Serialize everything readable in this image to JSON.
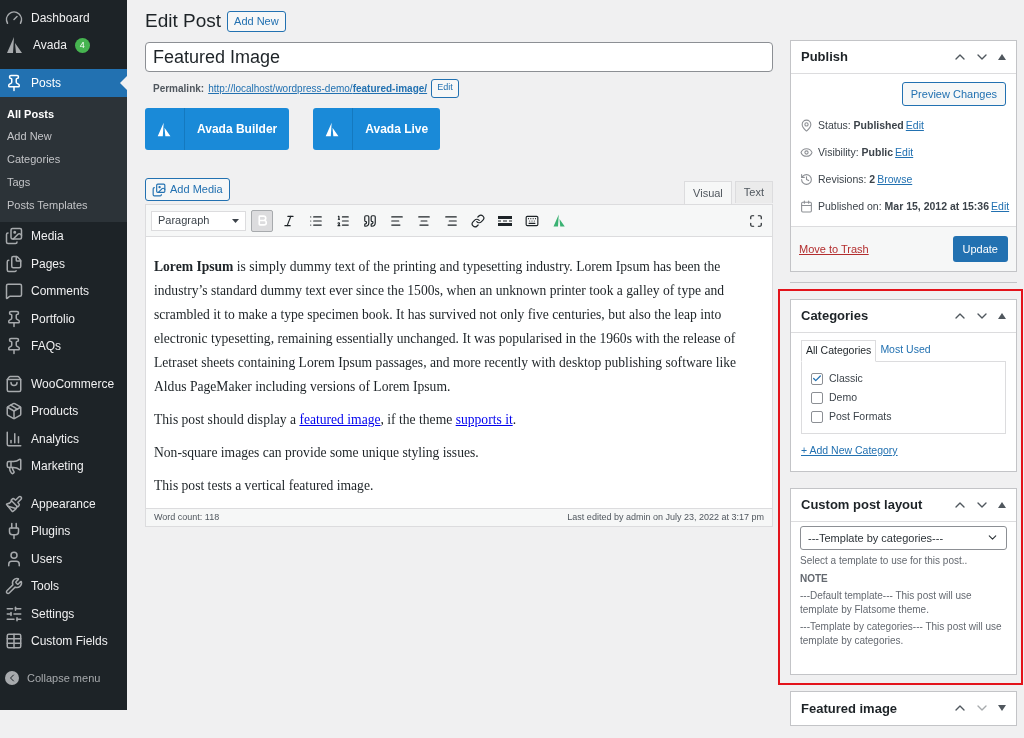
{
  "sidebar": {
    "groups": [
      [
        {
          "label": "Dashboard",
          "kind": "dashboard",
          "selected": false
        },
        {
          "label": "Avada",
          "kind": "avada",
          "selected": false,
          "badge": "4"
        }
      ],
      [
        {
          "label": "Posts",
          "kind": "pin",
          "selected": true,
          "children": [
            {
              "label": "All Posts",
              "selected": true
            },
            {
              "label": "Add New",
              "selected": false
            },
            {
              "label": "Categories",
              "selected": false
            },
            {
              "label": "Tags",
              "selected": false
            },
            {
              "label": "Posts Templates",
              "selected": false
            }
          ]
        },
        {
          "label": "Media",
          "kind": "media",
          "selected": false
        },
        {
          "label": "Pages",
          "kind": "pages",
          "selected": false
        },
        {
          "label": "Comments",
          "kind": "comments",
          "selected": false
        },
        {
          "label": "Portfolio",
          "kind": "pin",
          "selected": false
        },
        {
          "label": "FAQs",
          "kind": "pin",
          "selected": false
        }
      ],
      [
        {
          "label": "WooCommerce",
          "kind": "woo",
          "selected": false
        },
        {
          "label": "Products",
          "kind": "products",
          "selected": false
        },
        {
          "label": "Analytics",
          "kind": "analytics",
          "selected": false
        },
        {
          "label": "Marketing",
          "kind": "marketing",
          "selected": false
        }
      ],
      [
        {
          "label": "Appearance",
          "kind": "appearance",
          "selected": false
        },
        {
          "label": "Plugins",
          "kind": "plugins",
          "selected": false
        },
        {
          "label": "Users",
          "kind": "users",
          "selected": false
        },
        {
          "label": "Tools",
          "kind": "tools",
          "selected": false
        },
        {
          "label": "Settings",
          "kind": "settings",
          "selected": false
        },
        {
          "label": "Custom Fields",
          "kind": "fields",
          "selected": false
        }
      ]
    ],
    "collapse": "Collapse menu"
  },
  "heading": {
    "title": "Edit Post",
    "add_new": "Add New"
  },
  "post_title": "Featured Image",
  "permalink": {
    "label": "Permalink:",
    "url": "http://localhost/wordpress-demo/",
    "slug": "featured-image/",
    "edit": "Edit"
  },
  "builder_buttons": [
    "Avada Builder",
    "Avada Live"
  ],
  "editor": {
    "add_media": "Add Media",
    "tabs": [
      {
        "label": "Visual",
        "selected": true
      },
      {
        "label": "Text",
        "selected": false
      }
    ],
    "format": "Paragraph",
    "toolbar": [
      {
        "kind": "bold",
        "active": true
      },
      {
        "kind": "italic",
        "active": false
      },
      {
        "kind": "bullets",
        "active": false
      },
      {
        "kind": "numbers",
        "active": false
      },
      {
        "kind": "quote",
        "active": false
      },
      {
        "kind": "align-left",
        "active": false
      },
      {
        "kind": "align-center",
        "active": false
      },
      {
        "kind": "align-right",
        "active": false
      },
      {
        "kind": "link",
        "active": false
      },
      {
        "kind": "more",
        "active": false
      },
      {
        "kind": "keyboard",
        "active": false
      },
      {
        "kind": "avada",
        "active": false
      }
    ],
    "paragraphs": [
      [
        {
          "kind": "text",
          "text": "**Lorem Ipsum** is simply dummy text of the printing and typesetting industry. Lorem Ipsum has been the industry’s standard dummy text ever since the 1500s, when an unknown printer took a galley of type and scrambled it to make a type specimen book. It has survived not only five centuries, but also the leap into electronic typesetting, remaining essentially unchanged. It was popularised in the 1960s with the release of Letraset sheets containing Lorem Ipsum passages, and more recently with desktop publishing software like Aldus PageMaker including versions of Lorem Ipsum."
        }
      ],
      [
        {
          "kind": "text",
          "text": "This post should display a "
        },
        {
          "kind": "link",
          "text": "featured image"
        },
        {
          "kind": "text",
          "text": ", if the theme "
        },
        {
          "kind": "link",
          "text": "supports it"
        },
        {
          "kind": "text",
          "text": "."
        }
      ],
      [
        {
          "kind": "text",
          "text": "Non-square images can provide some unique styling issues."
        }
      ],
      [
        {
          "kind": "text",
          "text": "This post tests a vertical featured image."
        }
      ]
    ],
    "word_count": "Word count: 118",
    "last_edited": "Last edited by admin on July 23, 2022 at 3:17 pm"
  },
  "publish": {
    "title": "Publish",
    "expanded": true,
    "preview": "Preview Changes",
    "rows": [
      {
        "kind": "status",
        "label": "Status:",
        "value": "Published",
        "link": "Edit"
      },
      {
        "kind": "visibility",
        "label": "Visibility:",
        "value": "Public",
        "link": "Edit"
      },
      {
        "kind": "revisions",
        "label": "Revisions:",
        "value": "2",
        "link": "Browse"
      },
      {
        "kind": "date",
        "label": "Published on:",
        "value": "Mar 15, 2012 at 15:36",
        "link": "Edit"
      }
    ],
    "trash": "Move to Trash",
    "update": "Update"
  },
  "categories": {
    "title": "Categories",
    "expanded": true,
    "tabs": [
      {
        "label": "All Categories",
        "selected": true
      },
      {
        "label": "Most Used",
        "selected": false
      }
    ],
    "items": [
      {
        "label": "Classic",
        "checked": true
      },
      {
        "label": "Demo",
        "checked": false
      },
      {
        "label": "Post Formats",
        "checked": false
      }
    ],
    "add_new": "+ Add New Category"
  },
  "layout": {
    "title": "Custom post layout",
    "expanded": true,
    "select": "---Template by categories---",
    "help": "Select a template to use for this post..",
    "note_title": "NOTE",
    "notes": [
      "---Default template--- This post will use template by Flatsome theme.",
      "---Template by categories--- This post will use template by categories."
    ]
  },
  "featured": {
    "title": "Featured image",
    "expanded": false
  }
}
